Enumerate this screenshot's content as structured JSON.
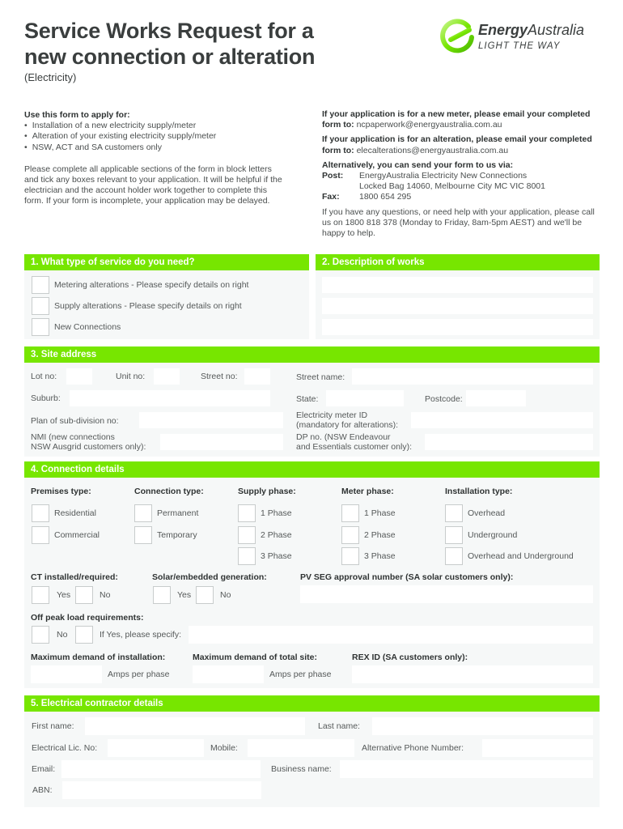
{
  "header": {
    "title_line1": "Service Works Request for a",
    "title_line2": "new connection or alteration",
    "subtitle": "(Electricity)"
  },
  "logo": {
    "icon": "energyaustralia-e-logo-icon",
    "name_bold": "Energy",
    "name_regular": "Australia",
    "tagline": "LIGHT THE WAY",
    "brand_color": "#77e600"
  },
  "intro_left": {
    "heading": "Use this form to apply for:",
    "bullets": [
      "Installation of a new electricity supply/meter",
      "Alteration of your existing electricity supply/meter",
      "NSW, ACT and SA customers only"
    ],
    "paragraph": "Please complete all applicable sections of the form in block letters and tick any boxes relevant to your application. It will be helpful if the electrician and the account holder work together to complete this form. If your form is incomplete, your application may be delayed."
  },
  "intro_right": {
    "new_meter_bold": "If your application is for a new meter, please email your completed form to:",
    "new_meter_email": "ncpaperwork@energyaustralia.com.au",
    "alteration_bold": "If your application is for an alteration, please email your completed form to:",
    "alteration_email": "elecalterations@energyaustralia.com.au",
    "alt_heading": "Alternatively, you can send your form to us via:",
    "post_label": "Post:",
    "post_line1": "EnergyAustralia Electricity New Connections",
    "post_line2": "Locked Bag 14060, Melbourne City MC VIC 8001",
    "fax_label": "Fax:",
    "fax_value": "1800 654 295",
    "help_text": "If you have any questions, or need help with your application, please call us on 1800 818 378 (Monday to Friday, 8am-5pm AEST) and we'll be happy to help."
  },
  "section1": {
    "title": "1. What type of service do you need?",
    "options": [
      "Metering alterations - Please specify details on right",
      "Supply alterations - Please specify details on right",
      "New Connections"
    ]
  },
  "section2": {
    "title": "2. Description of works",
    "lines": [
      "",
      "",
      ""
    ]
  },
  "section3": {
    "title": "3. Site address",
    "lot_no": "Lot no:",
    "unit_no": "Unit no:",
    "street_no": "Street no:",
    "street_name": "Street name:",
    "suburb": "Suburb:",
    "state": "State:",
    "postcode": "Postcode:",
    "plan_subdivision": "Plan of sub-division no:",
    "meter_id_l1": "Electricity meter ID",
    "meter_id_l2": "(mandatory for alterations):",
    "nmi_l1": "NMI (new connections",
    "nmi_l2": "NSW Ausgrid customers only):",
    "dp_l1": "DP no. (NSW Endeavour",
    "dp_l2": "and Essentials customer only):"
  },
  "section4": {
    "title": "4. Connection details",
    "columns": [
      {
        "heading": "Premises type:",
        "options": [
          "Residential",
          "Commercial"
        ]
      },
      {
        "heading": "Connection type:",
        "options": [
          "Permanent",
          "Temporary"
        ]
      },
      {
        "heading": "Supply phase:",
        "options": [
          "1 Phase",
          "2 Phase",
          "3 Phase"
        ]
      },
      {
        "heading": "Meter phase:",
        "options": [
          "1 Phase",
          "2 Phase",
          "3 Phase"
        ]
      },
      {
        "heading": "Installation type:",
        "options": [
          "Overhead",
          "Underground",
          "Overhead and Underground"
        ]
      }
    ],
    "ct_heading": "CT installed/required:",
    "solar_heading": "Solar/embedded generation:",
    "pv_heading": "PV SEG approval number (SA solar customers only):",
    "yes": "Yes",
    "no": "No",
    "offpeak_heading": "Off peak load requirements:",
    "offpeak_no": "No",
    "offpeak_specify": "If Yes, please specify:",
    "max_install_heading": "Maximum demand of installation:",
    "max_site_heading": "Maximum demand of total site:",
    "rex_heading": "REX ID (SA customers only):",
    "amps_per_phase": "Amps per phase"
  },
  "section5": {
    "title": "5. Electrical contractor details",
    "first_name": "First name:",
    "last_name": "Last name:",
    "lic_no": "Electrical Lic. No:",
    "mobile": "Mobile:",
    "alt_phone": "Alternative Phone Number:",
    "email": "Email:",
    "business_name": "Business name:",
    "abn": "ABN:"
  }
}
